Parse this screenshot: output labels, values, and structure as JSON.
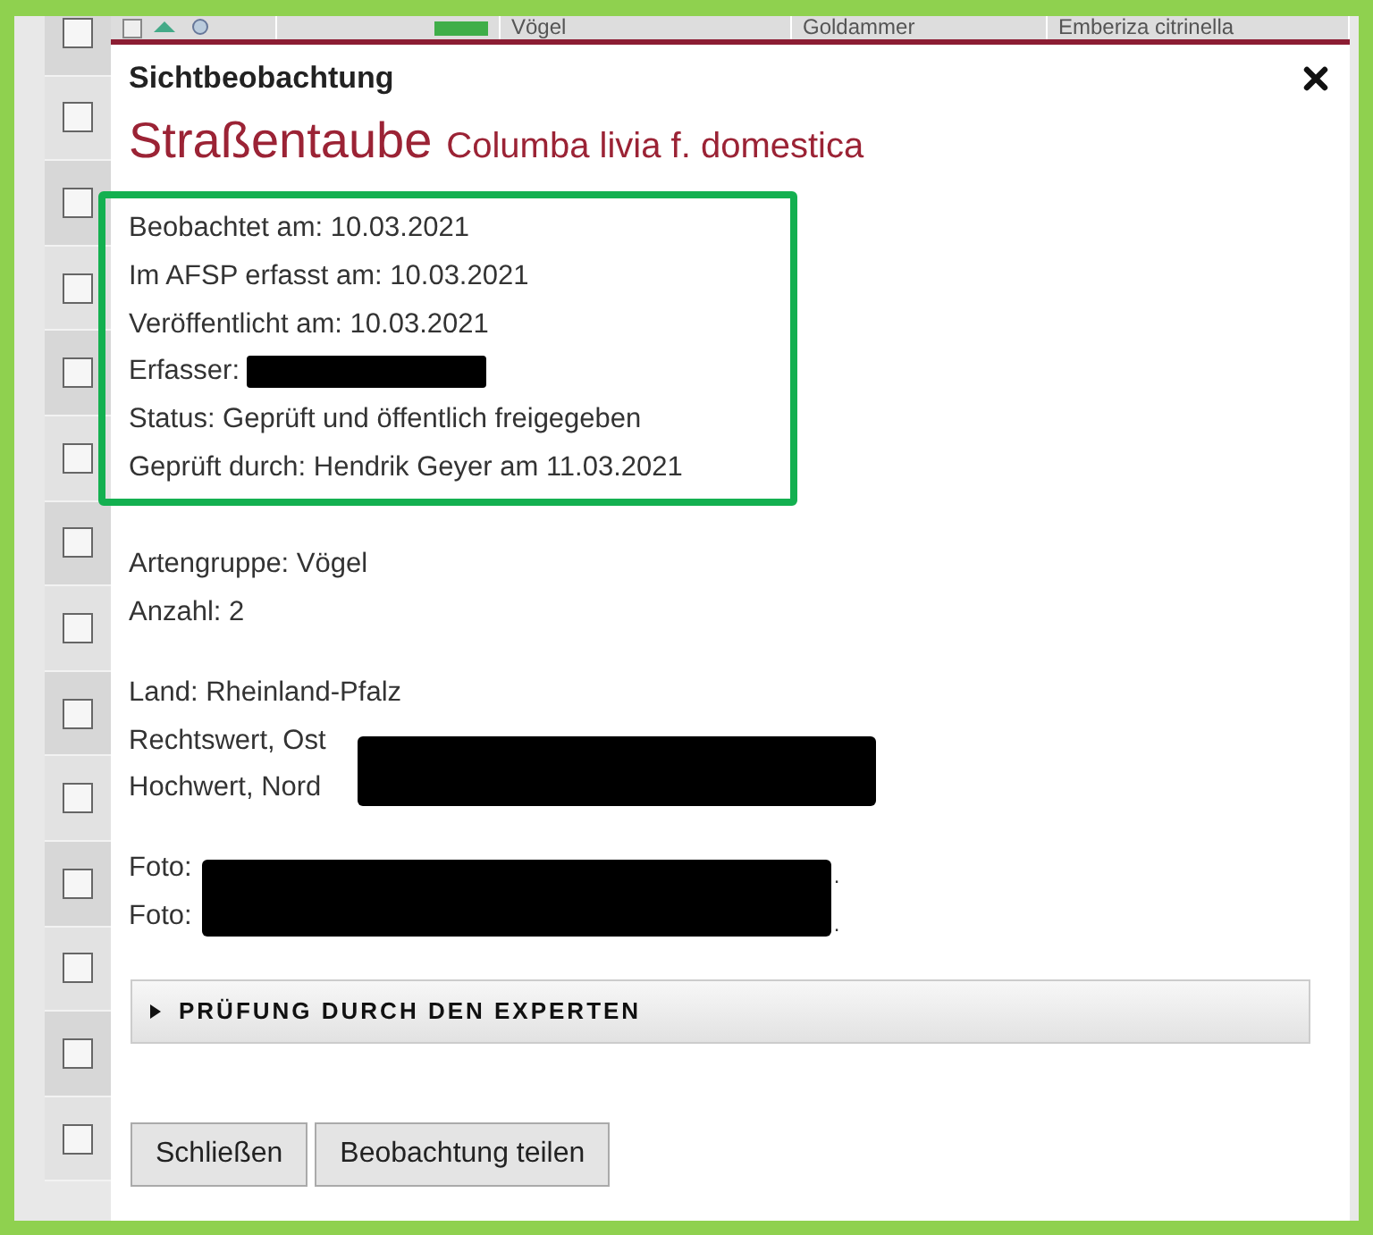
{
  "background_table": {
    "row": [
      "Vögel",
      "Goldammer",
      "Emberiza citrinella"
    ],
    "checkboxes": [
      {
        "checked": false
      },
      {
        "checked": false
      },
      {
        "checked": false
      },
      {
        "checked": false
      },
      {
        "checked": false
      },
      {
        "checked": false
      },
      {
        "checked": false
      },
      {
        "checked": false
      },
      {
        "checked": false
      },
      {
        "checked": false
      },
      {
        "checked": false
      },
      {
        "checked": false
      },
      {
        "checked": false
      },
      {
        "checked": false
      }
    ]
  },
  "dialog": {
    "title": "Sichtbeobachtung",
    "common_name": "Straßentaube",
    "scientific_name": "Columba livia f. domestica",
    "sections": [
      {
        "highlighted": true,
        "lines": [
          {
            "kind": "text",
            "label": "Beobachtet am: 10.03.2021"
          },
          {
            "kind": "text",
            "label": "Im AFSP erfasst am: 10.03.2021"
          },
          {
            "kind": "text",
            "label": "Veröffentlicht am: 10.03.2021"
          },
          {
            "kind": "redacted",
            "label": "Erfasser:"
          },
          {
            "kind": "text",
            "label": "Status: Geprüft und öffentlich freigegeben"
          },
          {
            "kind": "text",
            "label": "Geprüft durch: Hendrik Geyer am 11.03.2021"
          }
        ]
      },
      {
        "highlighted": false,
        "lines": [
          {
            "kind": "text",
            "label": "Artengruppe: Vögel"
          },
          {
            "kind": "text",
            "label": "Anzahl: 2"
          }
        ]
      },
      {
        "highlighted": false,
        "lines": [
          {
            "kind": "text",
            "label": "Land: Rheinland-Pfalz"
          },
          {
            "kind": "covered",
            "label": "Rechtswert, Ost"
          },
          {
            "kind": "covered",
            "label": "Hochwert, Nord"
          }
        ]
      },
      {
        "highlighted": false,
        "lines": [
          {
            "kind": "photo",
            "label": "Foto:",
            "suffix": "."
          },
          {
            "kind": "photo",
            "label": "Foto:",
            "suffix": "."
          }
        ]
      }
    ],
    "expander": {
      "label": "PRÜFUNG DURCH DEN EXPERTEN",
      "expanded": false
    },
    "buttons": [
      "Schließen",
      "Beobachtung teilen"
    ]
  }
}
